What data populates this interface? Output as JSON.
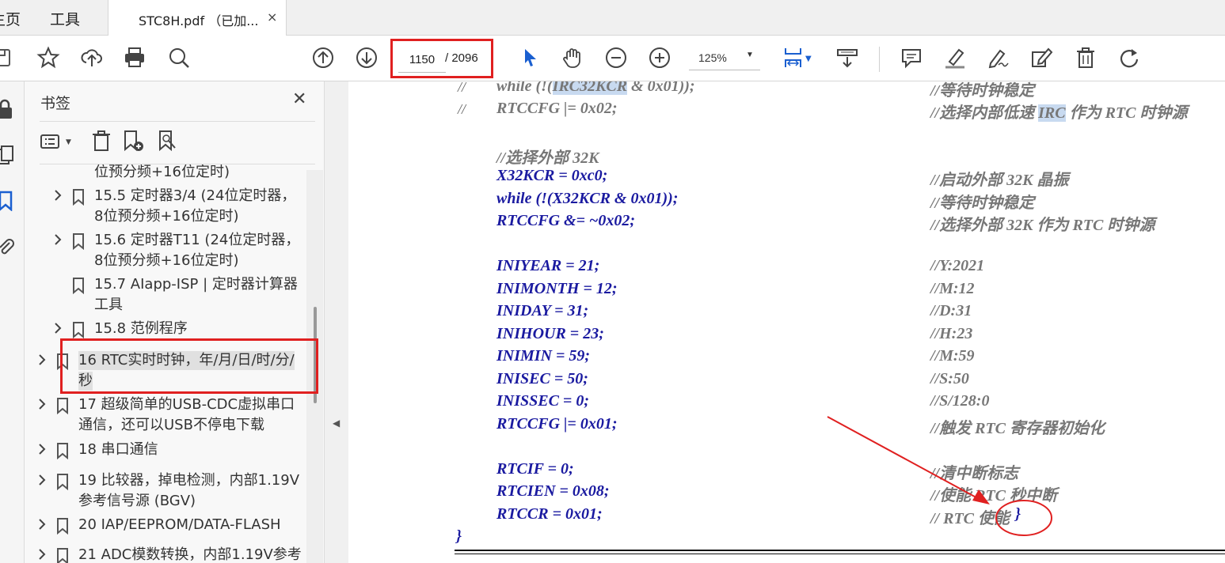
{
  "tabs": {
    "home": "主页",
    "tools": "工具",
    "document": "STC8H.pdf （已加...",
    "close": "×"
  },
  "toolbar": {
    "page_current": "1150",
    "page_total": "/ 2096",
    "zoom": "125%",
    "icons": [
      "save-icon",
      "star-icon",
      "upload-icon",
      "print-icon",
      "search-icon",
      "arrow-up-icon",
      "arrow-down-icon",
      "pointer-icon",
      "hand-icon",
      "zoom-out-icon",
      "zoom-in-icon",
      "fit-page-icon",
      "scroll-mode-icon",
      "comment-icon",
      "highlight-icon",
      "sign-icon",
      "edit-icon",
      "delete-icon",
      "rotate-icon"
    ]
  },
  "panel": {
    "title": "书签",
    "close": "✕",
    "bookmarks": [
      {
        "text": "位预分频+16位定时)",
        "expand": false,
        "level": 2
      },
      {
        "text": "15.5  定时器3/4 (24位定时器，",
        "text2": "8位预分频+16位定时)",
        "expand": true,
        "level": 2
      },
      {
        "text": "15.6  定时器T11 (24位定时器，",
        "text2": "8位预分频+16位定时)",
        "expand": true,
        "level": 2
      },
      {
        "text": "15.7  AIapp-ISP | 定时器计算器",
        "text2": "工具",
        "expand": false,
        "level": 2
      },
      {
        "text": "15.8  范例程序",
        "expand": true,
        "level": 2
      },
      {
        "text": "16  RTC实时时钟，年/月/日/时/分/",
        "text2": "秒",
        "expand": true,
        "level": 1,
        "selected": true
      },
      {
        "text": "17  超级简单的USB-CDC虚拟串口",
        "text2": "通信，还可以USB不停电下载",
        "expand": true,
        "level": 1
      },
      {
        "text": "18  串口通信",
        "expand": true,
        "level": 1
      },
      {
        "text": "19  比较器，掉电检测，内部1.19V",
        "text2": "参考信号源 (BGV)",
        "expand": true,
        "level": 1
      },
      {
        "text": "20  IAP/EEPROM/DATA-FLASH",
        "expand": true,
        "level": 1
      },
      {
        "text": "21  ADC模数转换，内部1.19V参考",
        "expand": true,
        "level": 1
      }
    ]
  },
  "code": {
    "lines": [
      {
        "prefix": "//",
        "code_pre": "while (!(",
        "code_hl": "IRC32KCR",
        "code_post": " & 0x01));",
        "comment": "//等待时钟稳定",
        "gray": true
      },
      {
        "prefix": "//",
        "code_pre": "RTCCFG |= 0x02;",
        "comment_pre": "//选择内部低速 ",
        "comment_hl": "IRC",
        "comment_post": " 作为 RTC 时钟源",
        "gray": true
      },
      {
        "code_pre": "//选择外部 32K",
        "gray": true
      },
      {
        "code_pre": "X32KCR = 0xc0;",
        "comment": "//启动外部 32K 晶振"
      },
      {
        "code_pre": "while (!(X32KCR & 0x01));",
        "comment": "//等待时钟稳定"
      },
      {
        "code_pre": "RTCCFG &= ~0x02;",
        "comment": "//选择外部 32K 作为 RTC 时钟源"
      },
      {
        "code_pre": "INIYEAR = 21;",
        "comment": "//Y:2021"
      },
      {
        "code_pre": "INIMONTH = 12;",
        "comment": "//M:12"
      },
      {
        "code_pre": "INIDAY = 31;",
        "comment": "//D:31"
      },
      {
        "code_pre": "INIHOUR = 23;",
        "comment": "//H:23"
      },
      {
        "code_pre": "INIMIN = 59;",
        "comment": "//M:59"
      },
      {
        "code_pre": "INISEC = 50;",
        "comment": "//S:50"
      },
      {
        "code_pre": "INISSEC = 0;",
        "comment": "//S/128:0"
      },
      {
        "code_pre": "RTCCFG |= 0x01;",
        "comment": "//触发 RTC 寄存器初始化"
      },
      {
        "code_pre": "RTCIF = 0;",
        "comment": "//清中断标志"
      },
      {
        "code_pre": "RTCIEN = 0x08;",
        "comment": "//使能 RTC 秒中断"
      },
      {
        "code_pre": "RTCCR = 0x01;",
        "comment": "// RTC 使能",
        "brace": "}"
      },
      {
        "code_pre": "}"
      }
    ]
  },
  "annotation_color": "#e02020"
}
